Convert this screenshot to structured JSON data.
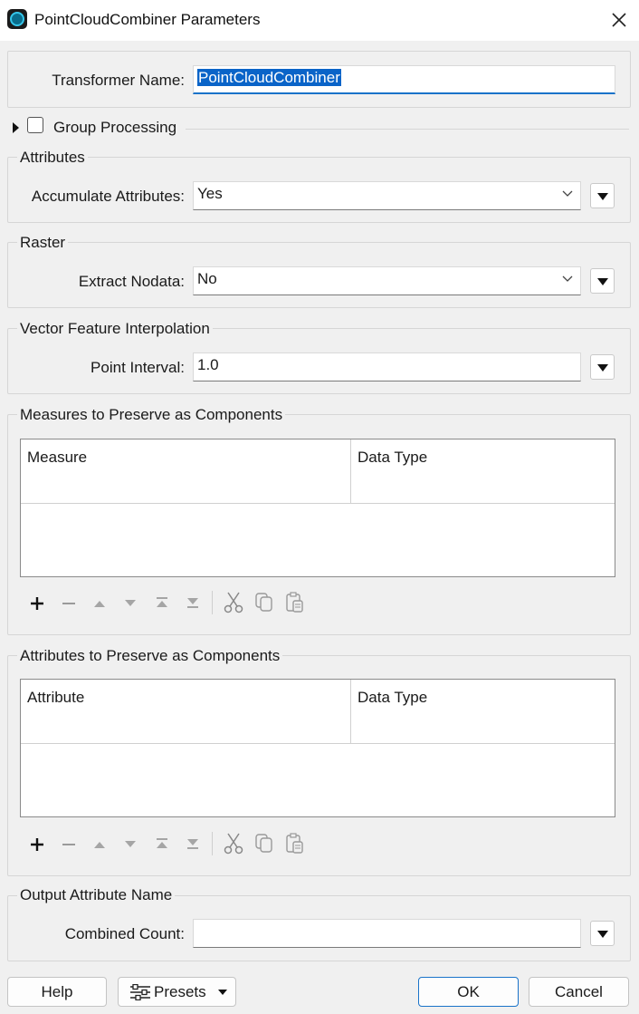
{
  "window": {
    "title": "PointCloudCombiner Parameters"
  },
  "transformer": {
    "label": "Transformer Name:",
    "value": "PointCloudCombiner"
  },
  "group_processing": {
    "label": "Group Processing",
    "checked": false
  },
  "attributes_section": {
    "title": "Attributes",
    "accumulate_label": "Accumulate Attributes:",
    "accumulate_value": "Yes"
  },
  "raster_section": {
    "title": "Raster",
    "nodata_label": "Extract Nodata:",
    "nodata_value": "No"
  },
  "vector_section": {
    "title": "Vector Feature Interpolation",
    "interval_label": "Point Interval:",
    "interval_value": "1.0"
  },
  "measures_section": {
    "title": "Measures to Preserve as Components",
    "columns": [
      "Measure",
      "Data Type"
    ]
  },
  "attributes_preserve_section": {
    "title": "Attributes to Preserve as Components",
    "columns": [
      "Attribute",
      "Data Type"
    ]
  },
  "output_section": {
    "title": "Output Attribute Name",
    "count_label": "Combined Count:",
    "count_value": ""
  },
  "footer": {
    "help": "Help",
    "presets": "Presets",
    "ok": "OK",
    "cancel": "Cancel"
  },
  "icons": {
    "app": "point-cloud-icon",
    "close": "close-icon",
    "toolbar": [
      "add-icon",
      "remove-icon",
      "move-up-icon",
      "move-down-icon",
      "move-top-icon",
      "move-bottom-icon",
      "cut-icon",
      "copy-icon",
      "paste-icon"
    ]
  },
  "colors": {
    "accent": "#1a73c9",
    "selection": "#0a64c8"
  }
}
